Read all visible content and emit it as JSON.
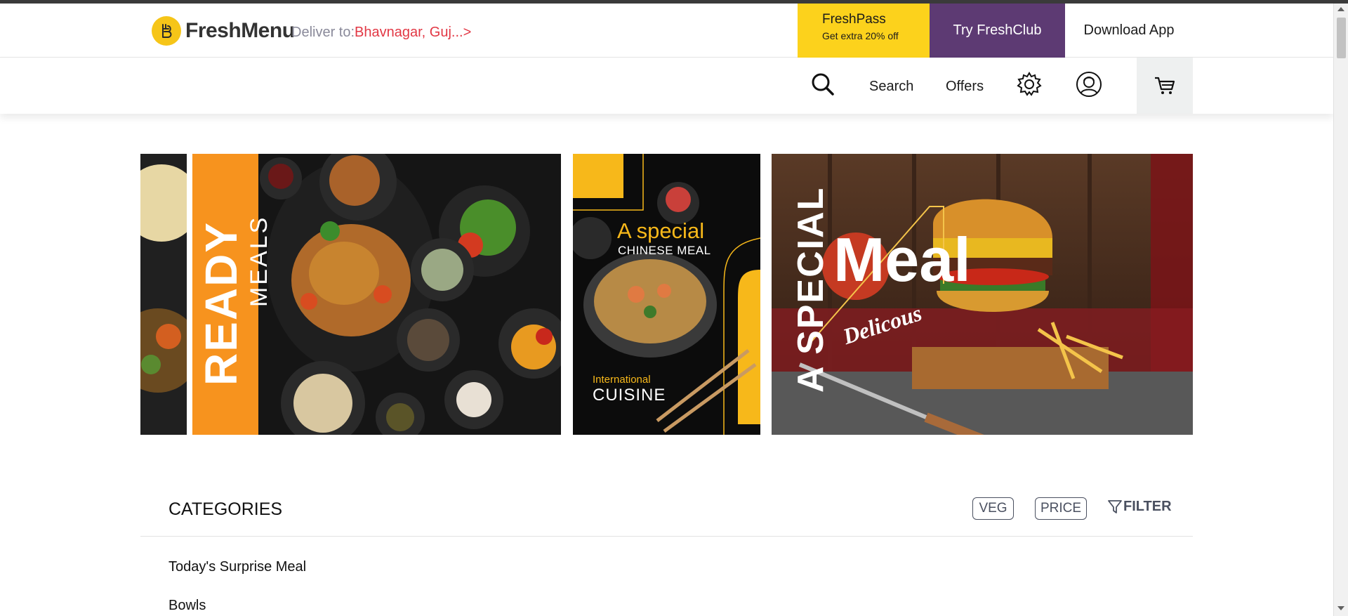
{
  "header": {
    "logo_text": "FreshMenu",
    "deliver_label": "Deliver to:",
    "deliver_location": "Bhavnagar, Guj...>",
    "freshpass_title": "FreshPass",
    "freshpass_sub": "Get extra 20% off",
    "freshclub_label": "Try FreshClub",
    "download_label": "Download App"
  },
  "nav": {
    "search_label": "Search",
    "offers_label": "Offers",
    "icons": [
      "search-icon",
      "settings-icon",
      "profile-icon",
      "cart-icon"
    ]
  },
  "banners": [
    {
      "line1": "READY",
      "line2": "MEALS"
    },
    {
      "line1": "A special",
      "line2": "CHINESE MEAL",
      "line3": "International",
      "line4": "CUISINE"
    },
    {
      "line1": "A SPECIAL",
      "line2": "Meal",
      "line3": "Delicous"
    }
  ],
  "categories": {
    "title": "CATEGORIES",
    "veg_label": "VEG",
    "price_label": "PRICE",
    "filter_label": "FILTER",
    "items": [
      "Today's Surprise Meal",
      "Bowls"
    ]
  },
  "colors": {
    "freshpass_bg": "#fcd21c",
    "freshclub_bg": "#5d3a73",
    "location_red": "#e23744",
    "ready_orange": "#f7931e",
    "chinese_yellow": "#f7b81a"
  }
}
